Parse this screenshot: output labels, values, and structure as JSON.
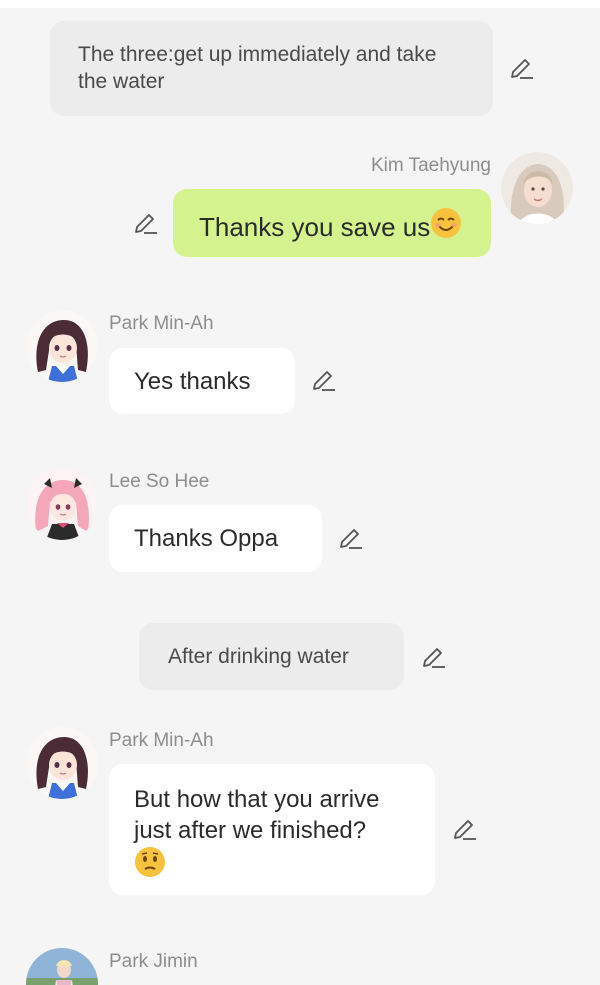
{
  "messages": [
    {
      "kind": "narration",
      "text": "The three:get up immediately and take the water"
    },
    {
      "kind": "outgoing",
      "sender": "Kim Taehyung",
      "text": "Thanks you save us",
      "emoji": "smiling-face-emoji"
    },
    {
      "kind": "incoming",
      "sender": "Park Min-Ah",
      "text": "Yes thanks"
    },
    {
      "kind": "incoming",
      "sender": "Lee So Hee",
      "text": "Thanks Oppa"
    },
    {
      "kind": "narration",
      "text": "After drinking water"
    },
    {
      "kind": "incoming",
      "sender": "Park Min-Ah",
      "text": "But how that you arrive just after we finished?",
      "emoji": "worried-face-emoji"
    },
    {
      "kind": "incoming",
      "sender": "Park Jimin",
      "text": ""
    }
  ],
  "icons": {
    "edit": "pencil-edit-icon"
  },
  "colors": {
    "background": "#f5f5f5",
    "outgoing_bubble": "#d4f38f",
    "incoming_bubble": "#ffffff",
    "narration_bubble": "#ececec",
    "sender_name": "#8d8d8d"
  }
}
